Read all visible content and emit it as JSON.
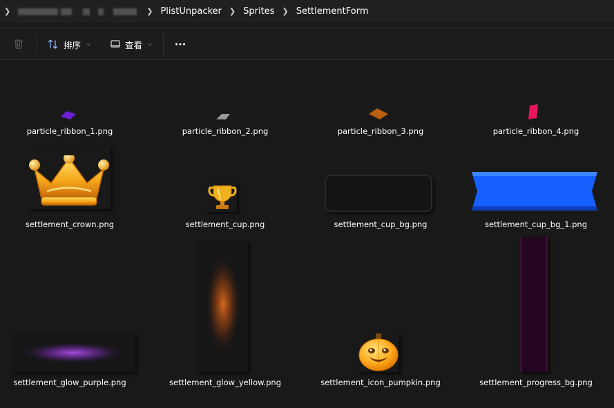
{
  "address_bar": {
    "breadcrumbs": [
      "PlistUnpacker",
      "Sprites",
      "SettlementForm"
    ]
  },
  "toolbar": {
    "sort_label": "排序",
    "view_label": "查看",
    "more_label": "..."
  },
  "files": [
    {
      "name": "particle_ribbon_1.png"
    },
    {
      "name": "particle_ribbon_2.png"
    },
    {
      "name": "particle_ribbon_3.png"
    },
    {
      "name": "particle_ribbon_4.png"
    },
    {
      "name": "settlement_crown.png"
    },
    {
      "name": "settlement_cup.png"
    },
    {
      "name": "settlement_cup_bg.png"
    },
    {
      "name": "settlement_cup_bg_1.png"
    },
    {
      "name": "settlement_glow_purple.png"
    },
    {
      "name": "settlement_glow_yellow.png"
    },
    {
      "name": "settlement_icon_pumpkin.png"
    },
    {
      "name": "settlement_progress_bg.png"
    }
  ],
  "colors": {
    "background": "#191919",
    "ribbon_purple": "#6a1fd6",
    "ribbon_gray": "#9a9a9a",
    "ribbon_orange": "#b8600e",
    "ribbon_pink": "#e8145e",
    "banner_blue": "#1760ff",
    "progress_dark": "#250620"
  }
}
